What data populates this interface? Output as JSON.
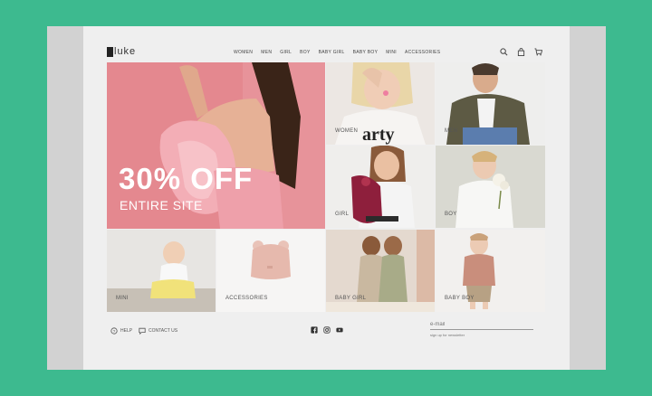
{
  "brand": {
    "logo_text": "luke"
  },
  "nav": {
    "items": [
      "WOMEN",
      "MEN",
      "GIRL",
      "BOY",
      "BABY GIRL",
      "BABY BOY",
      "MINI",
      "ACCESSORIES"
    ]
  },
  "header_icons": [
    "search-icon",
    "bag-icon",
    "cart-icon"
  ],
  "hero": {
    "headline": "30% OFF",
    "subline": "ENTIRE SITE"
  },
  "tiles": {
    "women": "WOMEN",
    "men": "MEN",
    "girl": "GIRL",
    "boy": "BOY",
    "mini": "MINI",
    "accessories": "ACCESSORIES",
    "baby_girl": "BABY GIRL",
    "baby_boy": "BABY BOY"
  },
  "footer": {
    "help": "HELP",
    "contact": "CONTACT US",
    "social": [
      "facebook-icon",
      "instagram-icon",
      "youtube-icon"
    ],
    "email_placeholder": "e-mail",
    "newsletter_note": "sign up for newsletter"
  },
  "colors": {
    "background": "#3dba8f",
    "hero_pink": "#e2868f",
    "page_bg": "#efefef"
  }
}
